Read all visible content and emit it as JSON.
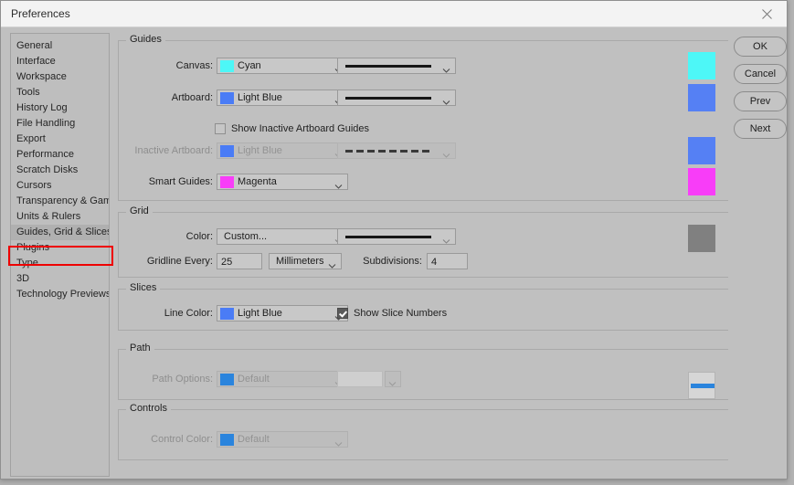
{
  "window": {
    "title": "Preferences",
    "close_icon": "close-icon"
  },
  "sidebar": {
    "items": [
      {
        "label": "General",
        "selected": false
      },
      {
        "label": "Interface",
        "selected": false
      },
      {
        "label": "Workspace",
        "selected": false
      },
      {
        "label": "Tools",
        "selected": false
      },
      {
        "label": "History Log",
        "selected": false
      },
      {
        "label": "File Handling",
        "selected": false
      },
      {
        "label": "Export",
        "selected": false
      },
      {
        "label": "Performance",
        "selected": false
      },
      {
        "label": "Scratch Disks",
        "selected": false
      },
      {
        "label": "Cursors",
        "selected": false
      },
      {
        "label": "Transparency & Gamut",
        "selected": false
      },
      {
        "label": "Units & Rulers",
        "selected": false
      },
      {
        "label": "Guides, Grid & Slices",
        "selected": true
      },
      {
        "label": "Plugins",
        "selected": false
      },
      {
        "label": "Type",
        "selected": false
      },
      {
        "label": "3D",
        "selected": false
      },
      {
        "label": "Technology Previews",
        "selected": false
      }
    ],
    "highlight_color": "#ee0000"
  },
  "groups": {
    "guides": {
      "title": "Guides",
      "canvas": {
        "label": "Canvas:",
        "color_name": "Cyan",
        "color_hex": "#4df7f7",
        "line_style": "solid",
        "swatch_hex": "#4df7f7"
      },
      "artboard": {
        "label": "Artboard:",
        "color_name": "Light Blue",
        "color_hex": "#4a7cf6",
        "line_style": "solid",
        "swatch_hex": "#5580f4"
      },
      "show_inactive": {
        "label": "Show Inactive Artboard Guides",
        "checked": false
      },
      "inactive_artboard": {
        "label": "Inactive Artboard:",
        "color_name": "Light Blue",
        "color_hex": "#4a7cf6",
        "line_style": "dashed",
        "swatch_hex": "#5580f4",
        "disabled": true
      },
      "smart_guides": {
        "label": "Smart Guides:",
        "color_name": "Magenta",
        "color_hex": "#f83df8",
        "swatch_hex": "#f83df8"
      }
    },
    "grid": {
      "title": "Grid",
      "color": {
        "label": "Color:",
        "color_name": "Custom...",
        "line_style": "solid",
        "swatch_hex": "#808080"
      },
      "gridline_every": {
        "label": "Gridline Every:",
        "value": "25",
        "unit": "Millimeters"
      },
      "subdivisions": {
        "label": "Subdivisions:",
        "value": "4"
      }
    },
    "slices": {
      "title": "Slices",
      "line_color": {
        "label": "Line Color:",
        "color_name": "Light Blue",
        "color_hex": "#4a7cf6"
      },
      "show_slice_numbers": {
        "label": "Show Slice Numbers",
        "checked": true
      }
    },
    "path": {
      "title": "Path",
      "path_options": {
        "label": "Path Options:",
        "color_name": "Default",
        "color_hex": "#2a84dd",
        "disabled": true
      },
      "preview_line_hex": "#2a84dd"
    },
    "controls": {
      "title": "Controls",
      "control_color": {
        "label": "Control Color:",
        "color_name": "Default",
        "color_hex": "#2a84dd",
        "disabled": true
      }
    }
  },
  "buttons": {
    "ok": "OK",
    "cancel": "Cancel",
    "prev": "Prev",
    "next": "Next"
  }
}
